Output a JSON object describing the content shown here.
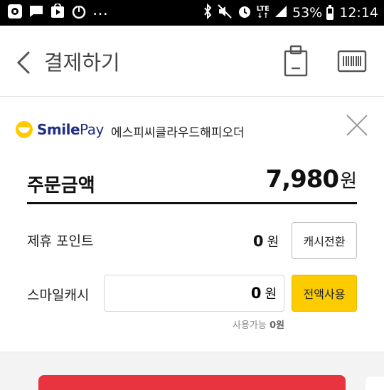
{
  "status_bar": {
    "battery": "53%",
    "battery_level": 0.53,
    "time": "12:14",
    "network": "LTE",
    "icons": [
      "notification-app-icon",
      "message-icon",
      "play-store-icon",
      "power-icon",
      "bluetooth-icon",
      "mute-icon",
      "alarm-icon",
      "lte-signal-icon",
      "battery-icon"
    ]
  },
  "header": {
    "title": "결제하기",
    "icons": [
      "back-arrow-icon",
      "shopping-bag-icon",
      "barcode-icon"
    ]
  },
  "payment": {
    "brand_smile": "Smile",
    "brand_pay": "Pay",
    "merchant": "에스피씨클라우드해피오더",
    "order_label": "주문금액",
    "order_amount": "7,980",
    "currency": "원",
    "points_label": "제휴 포인트",
    "points_value": "0",
    "cash_convert_label": "캐시전환",
    "smile_cash_label": "스마일캐시",
    "smile_cash_value": "0",
    "use_all_label": "전액사용",
    "available_label": "사용가능",
    "available_value": "0원"
  },
  "colors": {
    "accent_yellow": "#fccc00",
    "pay_red": "#e8343f",
    "brand_navy": "#1f2f86"
  }
}
